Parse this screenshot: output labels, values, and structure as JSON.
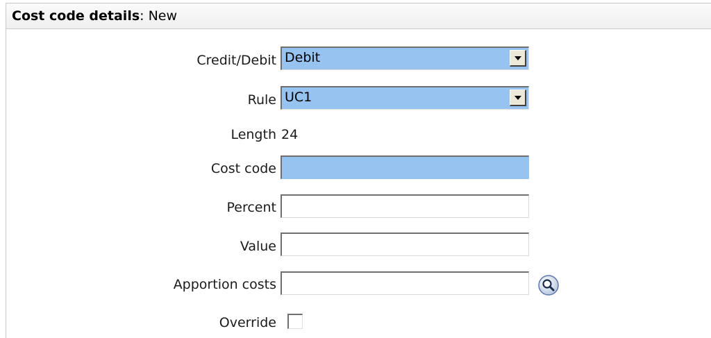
{
  "header": {
    "title_bold": "Cost code details",
    "title_rest": ": New"
  },
  "form": {
    "credit_debit": {
      "label": "Credit/Debit",
      "value": "Debit"
    },
    "rule": {
      "label": "Rule",
      "value": "UC1"
    },
    "length": {
      "label": "Length",
      "value": "24"
    },
    "cost_code": {
      "label": "Cost code",
      "value": ""
    },
    "percent": {
      "label": "Percent",
      "value": ""
    },
    "value": {
      "label": "Value",
      "value": ""
    },
    "apportion_costs": {
      "label": "Apportion costs",
      "value": ""
    },
    "override": {
      "label": "Override",
      "checked": false
    }
  },
  "icons": {
    "lookup": "magnifier-icon",
    "dropdown": "chevron-down-icon"
  },
  "colors": {
    "highlight": "#96c3ef"
  }
}
